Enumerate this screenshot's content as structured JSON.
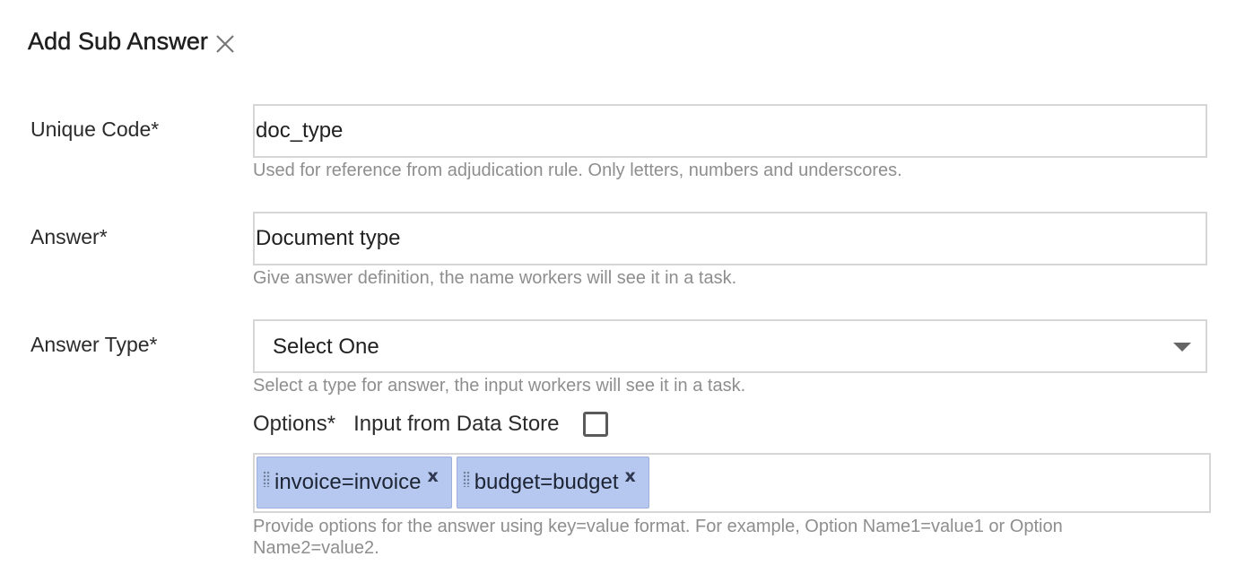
{
  "dialog": {
    "title": "Add Sub Answer",
    "close_icon": "close-icon"
  },
  "unique_code": {
    "label": "Unique Code*",
    "value": "doc_type",
    "help": "Used for reference from adjudication rule. Only letters, numbers and underscores."
  },
  "answer": {
    "label": "Answer*",
    "value": "Document type",
    "help": "Give answer definition, the name workers will see it in a task."
  },
  "answer_type": {
    "label": "Answer Type*",
    "selected": "Select One",
    "help": "Select a type for answer, the input workers will see it in a task."
  },
  "options": {
    "label": "Options*",
    "data_store_label": "Input from Data Store",
    "data_store_checked": false,
    "tags": [
      {
        "label": "invoice=invoice",
        "remove": "x"
      },
      {
        "label": "budget=budget",
        "remove": "x"
      }
    ],
    "help": "Provide options for the answer using key=value format. For example, Option Name1=value1 or Option Name2=value2."
  },
  "colors": {
    "tag_background": "#b6c8ef",
    "border": "#d6d6d6",
    "help_text": "#8e8e8e"
  }
}
